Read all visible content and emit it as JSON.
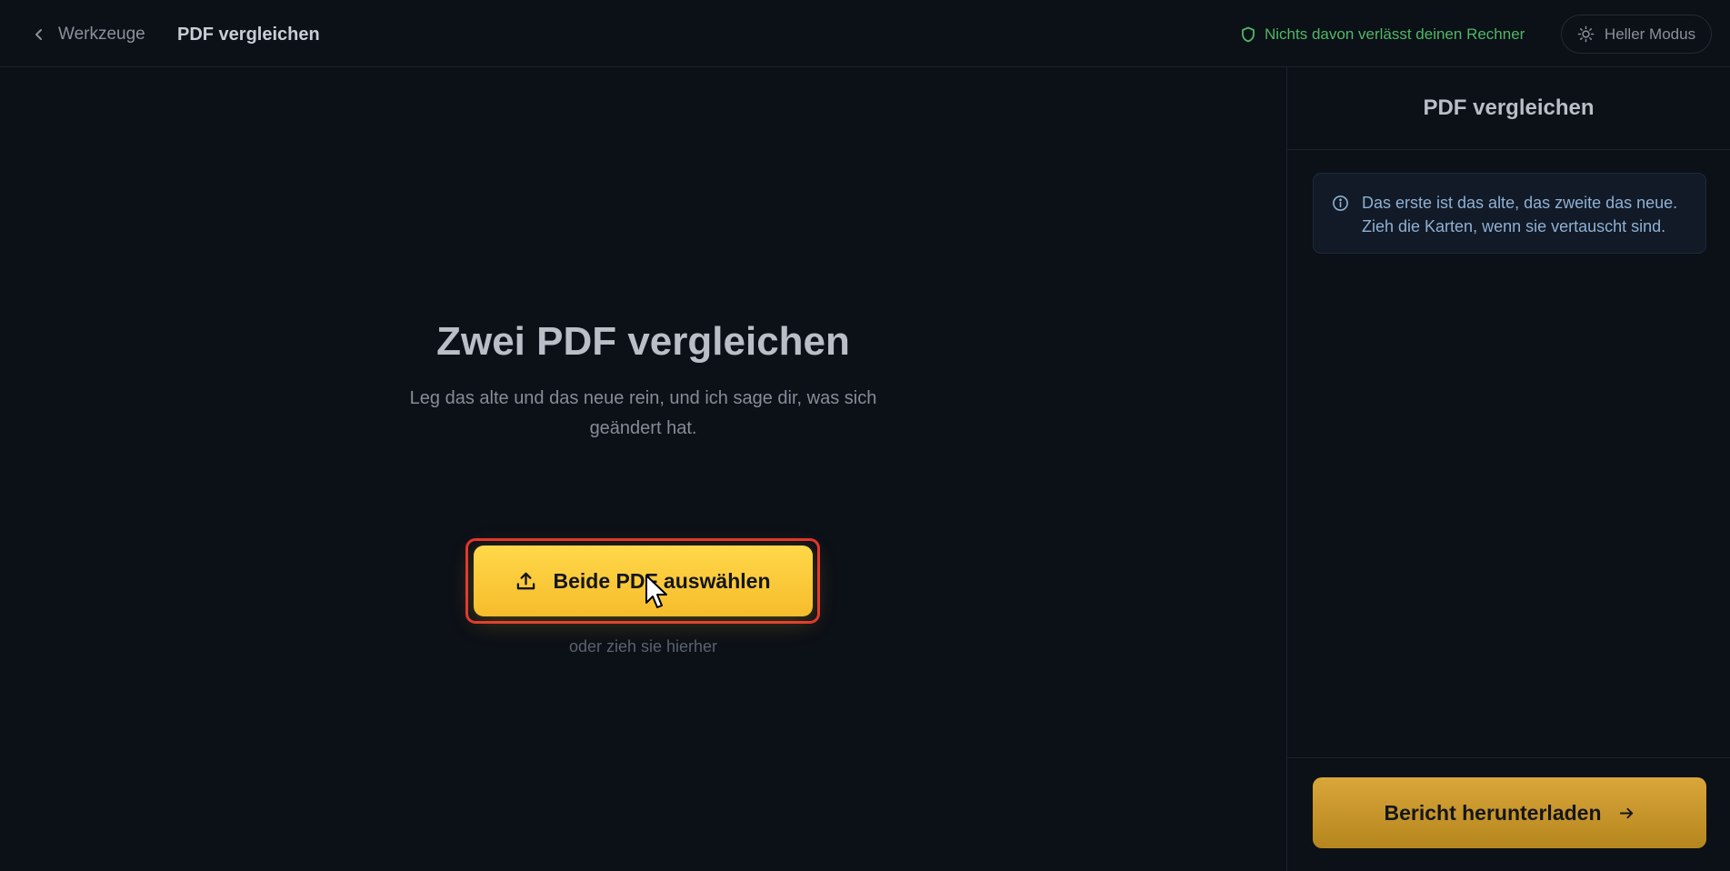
{
  "header": {
    "back_label": "Werkzeuge",
    "back_icon": "chevron-left-icon",
    "page_title": "PDF vergleichen",
    "privacy_text": "Nichts davon verlässt deinen Rechner",
    "privacy_icon": "shield-icon",
    "privacy_color": "#4fb866",
    "mode_toggle_label": "Heller Modus",
    "mode_toggle_icon": "sun-icon"
  },
  "main": {
    "title": "Zwei PDF vergleichen",
    "subtitle": "Leg das alte und das neue rein, und ich sage dir, was sich geändert hat.",
    "upload_button_label": "Beide PDF auswählen",
    "upload_icon": "upload-icon",
    "upload_button_color": "#fcc93b",
    "highlight_outline_color": "#e2342c",
    "drop_hint": "oder zieh sie hierher"
  },
  "sidebar": {
    "title": "PDF vergleichen",
    "info_icon": "info-icon",
    "info_text": "Das erste ist das alte, das zweite das neue. Zieh die Karten, wenn sie vertauscht sind.",
    "report_button_label": "Bericht herunterladen",
    "report_button_icon": "arrow-right-icon",
    "report_button_color": "#c8962b"
  }
}
